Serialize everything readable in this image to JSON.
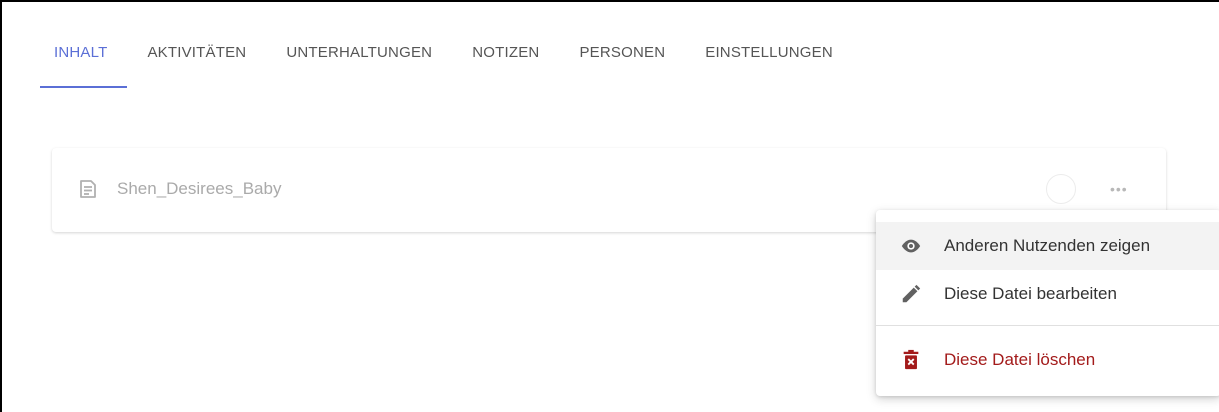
{
  "tabs": [
    {
      "label": "INHALT",
      "active": true
    },
    {
      "label": "AKTIVITÄTEN",
      "active": false
    },
    {
      "label": "UNTERHALTUNGEN",
      "active": false
    },
    {
      "label": "NOTIZEN",
      "active": false
    },
    {
      "label": "PERSONEN",
      "active": false
    },
    {
      "label": "EINSTELLUNGEN",
      "active": false
    }
  ],
  "file": {
    "name": "Shen_Desirees_Baby",
    "icon": "document-icon",
    "more_icon": "more-horizontal-icon",
    "more_glyph": "•••"
  },
  "context_menu": {
    "items": [
      {
        "label": "Anderen Nutzenden zeigen",
        "icon": "eye-icon"
      },
      {
        "label": "Diese Datei bearbeiten",
        "icon": "pencil-icon"
      },
      {
        "label": "Diese Datei löschen",
        "icon": "trash-icon",
        "danger": true
      }
    ]
  },
  "colors": {
    "accent": "#5b6fd6",
    "danger": "#a31b1b",
    "muted_text": "#aaaaaa"
  }
}
